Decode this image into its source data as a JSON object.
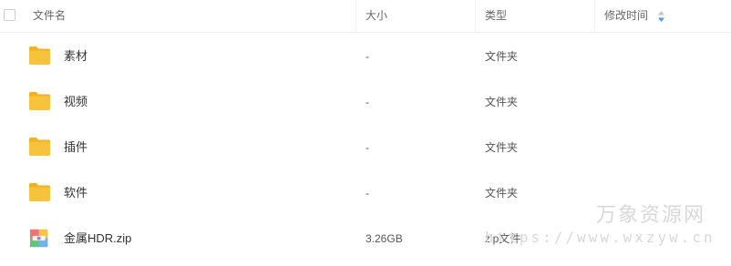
{
  "columns": {
    "name": "文件名",
    "size": "大小",
    "type": "类型",
    "modified": "修改时间"
  },
  "files": [
    {
      "name": "素材",
      "size": "-",
      "type": "文件夹",
      "icon": "folder-icon"
    },
    {
      "name": "视频",
      "size": "-",
      "type": "文件夹",
      "icon": "folder-icon"
    },
    {
      "name": "插件",
      "size": "-",
      "type": "文件夹",
      "icon": "folder-icon"
    },
    {
      "name": "软件",
      "size": "-",
      "type": "文件夹",
      "icon": "folder-icon"
    },
    {
      "name": "金属HDR.zip",
      "size": "3.26GB",
      "type": "zip文件",
      "icon": "zip-archive-icon"
    }
  ],
  "watermark": {
    "title": "万象资源网",
    "url": "https://www.wxzyw.cn"
  },
  "colors": {
    "folder": "#f7c23c",
    "folder_tab": "#f2b21e",
    "sort_accent": "#4a9cf0",
    "watermark": "#d8d8d8"
  }
}
